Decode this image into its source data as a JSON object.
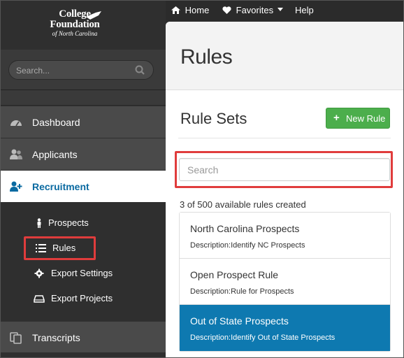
{
  "logo": {
    "line1": "College",
    "line2": "Foundation",
    "line3": "of North Carolina"
  },
  "sidebar": {
    "search_placeholder": "Search...",
    "items": [
      {
        "label": "Dashboard",
        "icon": "dashboard-icon"
      },
      {
        "label": "Applicants",
        "icon": "users-icon"
      },
      {
        "label": "Recruitment",
        "icon": "user-plus-icon",
        "active": true
      },
      {
        "label": "Transcripts",
        "icon": "copy-icon"
      }
    ],
    "subitems": [
      {
        "label": "Prospects",
        "icon": "person-icon"
      },
      {
        "label": "Rules",
        "icon": "list-icon"
      },
      {
        "label": "Export Settings",
        "icon": "gear-icon"
      },
      {
        "label": "Export Projects",
        "icon": "hdd-icon"
      }
    ]
  },
  "topnav": {
    "home": "Home",
    "favorites": "Favorites",
    "help": "Help"
  },
  "main": {
    "page_title": "Rules",
    "section_title": "Rule Sets",
    "new_rule_label": "New Rule",
    "search_placeholder": "Search",
    "count_text": "3 of 500 available rules created",
    "rules": [
      {
        "name": "North Carolina Prospects",
        "description": "Description:Identify NC Prospects"
      },
      {
        "name": "Open Prospect Rule",
        "description": "Description:Rule for Prospects"
      },
      {
        "name": "Out of State Prospects",
        "description": "Description:Identify Out of State Prospects",
        "selected": true
      }
    ]
  },
  "colors": {
    "accent": "#0e79b0",
    "sidebar_bg": "#2f2f2f",
    "nav_item_bg": "#4a4a4a",
    "success": "#4cae4c",
    "highlight": "#e03c3c"
  }
}
